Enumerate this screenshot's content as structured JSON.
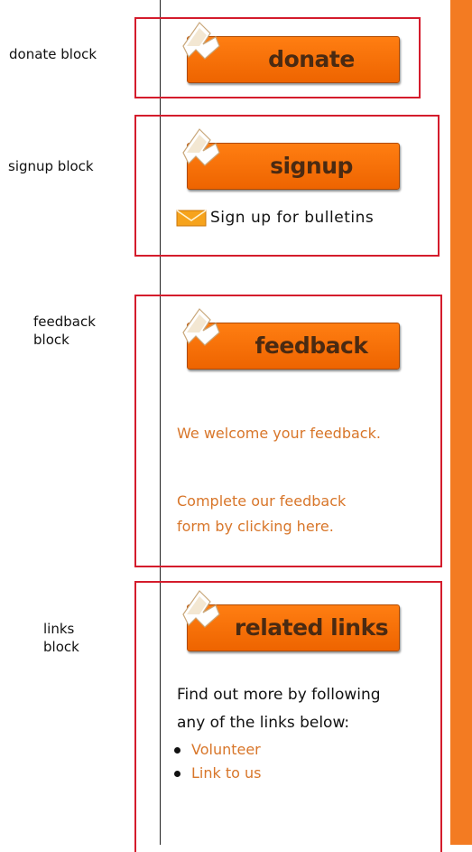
{
  "annotations": {
    "donate": "donate block",
    "signup": "signup block",
    "feedback_line1": "feedback",
    "feedback_line2": "block",
    "links_line1": "links",
    "links_line2": "block"
  },
  "donate_block": {
    "button_label": "donate"
  },
  "signup_block": {
    "button_label": "signup",
    "bulletin_link": "Sign up for bulletins"
  },
  "feedback_block": {
    "button_label": "feedback",
    "welcome_text": "We welcome your feedback.",
    "form_line1": "Complete our feedback",
    "form_line2": "form by clicking here."
  },
  "links_block": {
    "button_label": "related links",
    "intro_line1": "Find out more by following",
    "intro_line2": "any of the links below:",
    "links": [
      "Volunteer",
      "Link to us"
    ]
  },
  "colors": {
    "accent": "#f37b22",
    "button": "#f26c0d",
    "border": "#d41c2c",
    "link": "#d8762a"
  },
  "icons": {
    "button_logo": "ribbon-logo-icon",
    "bulletin": "envelope-icon"
  }
}
